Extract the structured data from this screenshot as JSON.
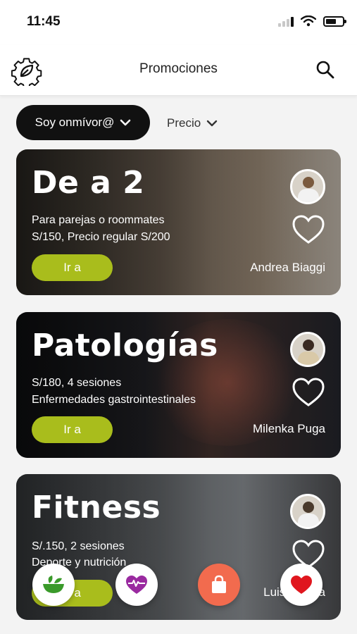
{
  "status": {
    "time": "11:45"
  },
  "header": {
    "title": "Promociones"
  },
  "filters": {
    "diet_label": "Soy onmívor@",
    "price_label": "Precio"
  },
  "promos": [
    {
      "title": "De a 2",
      "line1": "Para parejas o roommates",
      "line2": "S/150, Precio regular S/200",
      "cta": "Ir a",
      "nutritionist": "Andrea Biaggi"
    },
    {
      "title": "Patologías",
      "line1": "S/180, 4 sesiones",
      "line2": "Enfermedades gastrointestinales",
      "cta": "Ir a",
      "nutritionist": "Milenka Puga"
    },
    {
      "title": "Fitness",
      "line1": "S/.150, 2 sesiones",
      "line2": "Deporte y nutrición",
      "cta": "Ir a",
      "nutritionist": "Luis Ortega"
    }
  ],
  "fabs": [
    {
      "icon": "salad-bowl-icon",
      "color": "#3a9a2a"
    },
    {
      "icon": "heartbeat-icon",
      "color": "#9a2aa0"
    },
    {
      "icon": "shopping-bag-icon",
      "color": "#f26b4e"
    },
    {
      "icon": "heart-icon",
      "color": "#e0161e"
    }
  ],
  "colors": {
    "accent": "#a9bd1c",
    "filter_bg": "#111111"
  }
}
